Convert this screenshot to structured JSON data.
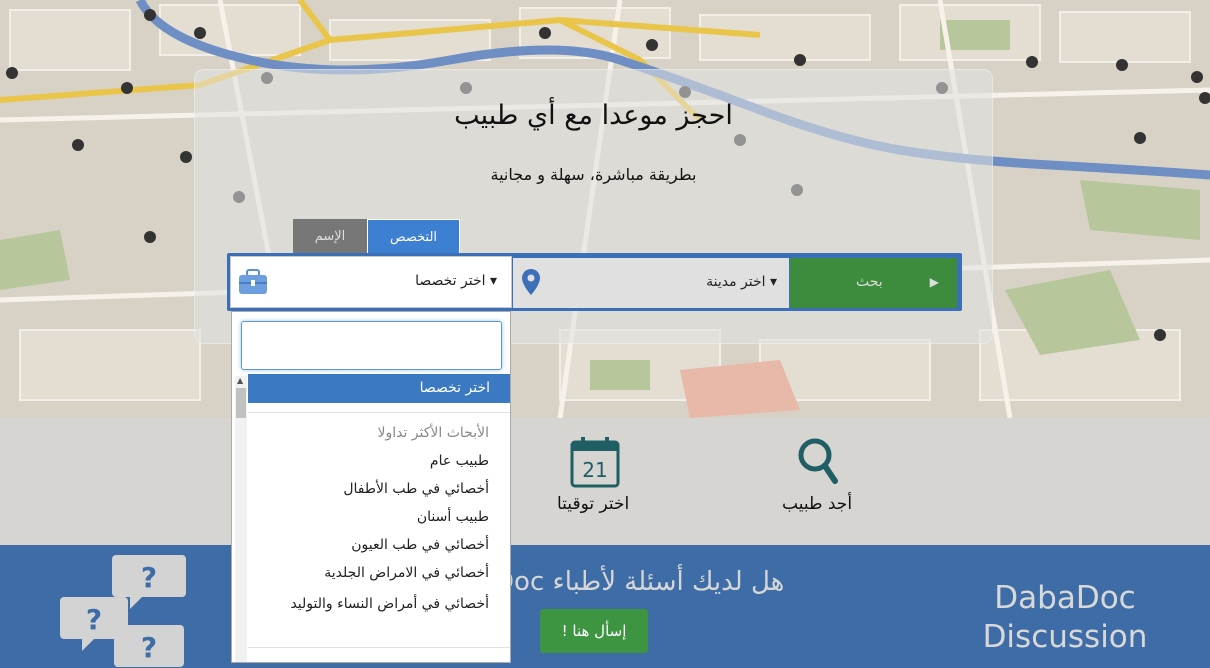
{
  "hero": {
    "title": "احجز موعدا مع أي طبيب",
    "subtitle": "بطريقة مباشرة، سهلة و مجانية"
  },
  "tabs": [
    {
      "label": "التخصص",
      "active": true
    },
    {
      "label": "الإسم",
      "active": false
    }
  ],
  "search": {
    "specialty_value": "اختر تخصصا",
    "city_value": "اختر مدينة",
    "search_button": "بحث"
  },
  "dropdown": {
    "selected": "اختر تخصصا",
    "group_label": "الأبحاث الأكثر تداولا",
    "items": [
      "طبيب عام",
      "أخصائي في طب الأطفال",
      "طبيب أسنان",
      "أخصائي في طب العيون",
      "أخصائي في الامراض الجلدية",
      "أخصائي في أمراض النساء والتوليد"
    ]
  },
  "features": {
    "find_doctor": "أجد طبيب",
    "choose_time": "اختر توقيتا",
    "calendar_day": "21"
  },
  "discussion": {
    "question": "هل لديك أسئلة لأطباء DabaDoc",
    "ask_button": "إسأل هنا !",
    "brand_line1": "DabaDoc",
    "brand_line2": "Discussion"
  },
  "colors": {
    "primary_blue": "#3b6fb7",
    "green": "#3d8b3d",
    "teal_icon": "#1f5e64"
  }
}
